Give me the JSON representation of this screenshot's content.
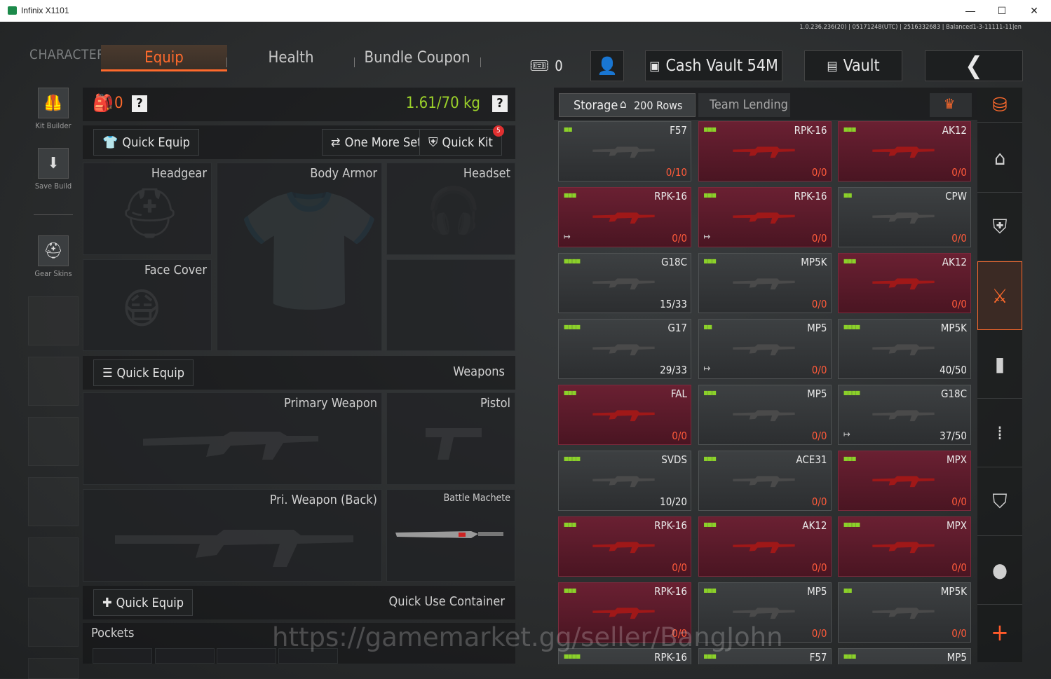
{
  "window": {
    "title": "Infinix X1101",
    "minimize": "—",
    "maximize": "☐",
    "close": "✕"
  },
  "version_info": "1.0.236.236(20) | 05171248(UTC) | 2516332683 | Balanced1-3-11111-11|en",
  "nav": {
    "character": "CHARACTER",
    "tabs": [
      "Equip",
      "Health",
      "Bundle Coupon"
    ],
    "active_tab": "Equip",
    "ticket_count": "0",
    "cash_vault": "Cash Vault 54M",
    "vault": "Vault"
  },
  "left_tools": [
    {
      "label": "Kit Builder",
      "icon": "armor-vest-icon"
    },
    {
      "label": "Save Build",
      "icon": "download-icon"
    },
    {
      "label": "Gear Skins",
      "icon": "helmet-icon"
    }
  ],
  "loadout": {
    "backpack_count": "0",
    "help": "?",
    "weight": "1.61/70 kg",
    "quick_equip": "Quick Equip",
    "one_more_set": "One More Set",
    "quick_kit": "Quick Kit",
    "quick_kit_badge": "5",
    "gear_slots": [
      "Headgear",
      "Body Armor",
      "Headset",
      "Face Cover"
    ],
    "weapons_header": "Weapons",
    "weapons_quick_equip": "Quick Equip",
    "weapon_slots": [
      "Primary Weapon",
      "Pistol",
      "Pri. Weapon (Back)",
      "Battle Machete"
    ],
    "container_quick_equip": "Quick Equip",
    "quick_use_container": "Quick Use Container",
    "pockets": "Pockets"
  },
  "storage": {
    "label": "Storage",
    "rows": "200 Rows",
    "team_lending": "Team Lending",
    "items": [
      {
        "name": "F57",
        "count": "0/10",
        "red": false,
        "tier": 2,
        "exit": false
      },
      {
        "name": "RPK-16",
        "count": "0/0",
        "red": true,
        "tier": 3,
        "exit": false
      },
      {
        "name": "AK12",
        "count": "0/0",
        "red": true,
        "tier": 3,
        "exit": false
      },
      {
        "name": "RPK-16",
        "count": "0/0",
        "red": true,
        "tier": 3,
        "exit": true
      },
      {
        "name": "RPK-16",
        "count": "0/0",
        "red": true,
        "tier": 3,
        "exit": true
      },
      {
        "name": "CPW",
        "count": "0/0",
        "red": false,
        "tier": 2,
        "exit": false
      },
      {
        "name": "G18C",
        "count": "15/33",
        "red": false,
        "tier": 4,
        "exit": false
      },
      {
        "name": "MP5K",
        "count": "0/0",
        "red": false,
        "tier": 3,
        "exit": false
      },
      {
        "name": "AK12",
        "count": "0/0",
        "red": true,
        "tier": 3,
        "exit": false
      },
      {
        "name": "G17",
        "count": "29/33",
        "red": false,
        "tier": 4,
        "exit": false
      },
      {
        "name": "MP5",
        "count": "0/0",
        "red": false,
        "tier": 2,
        "exit": true
      },
      {
        "name": "MP5K",
        "count": "40/50",
        "red": false,
        "tier": 4,
        "exit": false
      },
      {
        "name": "FAL",
        "count": "0/0",
        "red": true,
        "tier": 3,
        "exit": false
      },
      {
        "name": "MP5",
        "count": "0/0",
        "red": false,
        "tier": 3,
        "exit": false
      },
      {
        "name": "G18C",
        "count": "37/50",
        "red": false,
        "tier": 4,
        "exit": true
      },
      {
        "name": "SVDS",
        "count": "10/20",
        "red": false,
        "tier": 4,
        "exit": false
      },
      {
        "name": "ACE31",
        "count": "0/0",
        "red": false,
        "tier": 3,
        "exit": false
      },
      {
        "name": "MPX",
        "count": "0/0",
        "red": true,
        "tier": 3,
        "exit": false
      },
      {
        "name": "RPK-16",
        "count": "0/0",
        "red": true,
        "tier": 3,
        "exit": false
      },
      {
        "name": "AK12",
        "count": "0/0",
        "red": true,
        "tier": 3,
        "exit": false
      },
      {
        "name": "MPX",
        "count": "0/0",
        "red": true,
        "tier": 4,
        "exit": false
      },
      {
        "name": "RPK-16",
        "count": "0/0",
        "red": true,
        "tier": 3,
        "exit": false
      },
      {
        "name": "MP5",
        "count": "0/0",
        "red": false,
        "tier": 3,
        "exit": false
      },
      {
        "name": "MP5K",
        "count": "0/0",
        "red": false,
        "tier": 2,
        "exit": false
      },
      {
        "name": "RPK-16",
        "count": "",
        "red": false,
        "tier": 4,
        "exit": false
      },
      {
        "name": "F57",
        "count": "",
        "red": false,
        "tier": 3,
        "exit": false
      },
      {
        "name": "MP5",
        "count": "",
        "red": false,
        "tier": 3,
        "exit": false
      }
    ]
  },
  "right_categories": [
    "stack-icon",
    "home-icon",
    "armor-icon",
    "gun-icon",
    "magazine-icon",
    "ammo-icon",
    "vest-icon",
    "grenade-icon",
    "add-icon"
  ],
  "watermark": "https://gamemarket.gg/seller/BangJohn",
  "colors": {
    "accent": "#ff6a2c",
    "weight_green": "#9bd12a",
    "red_item": "#6a2032"
  }
}
